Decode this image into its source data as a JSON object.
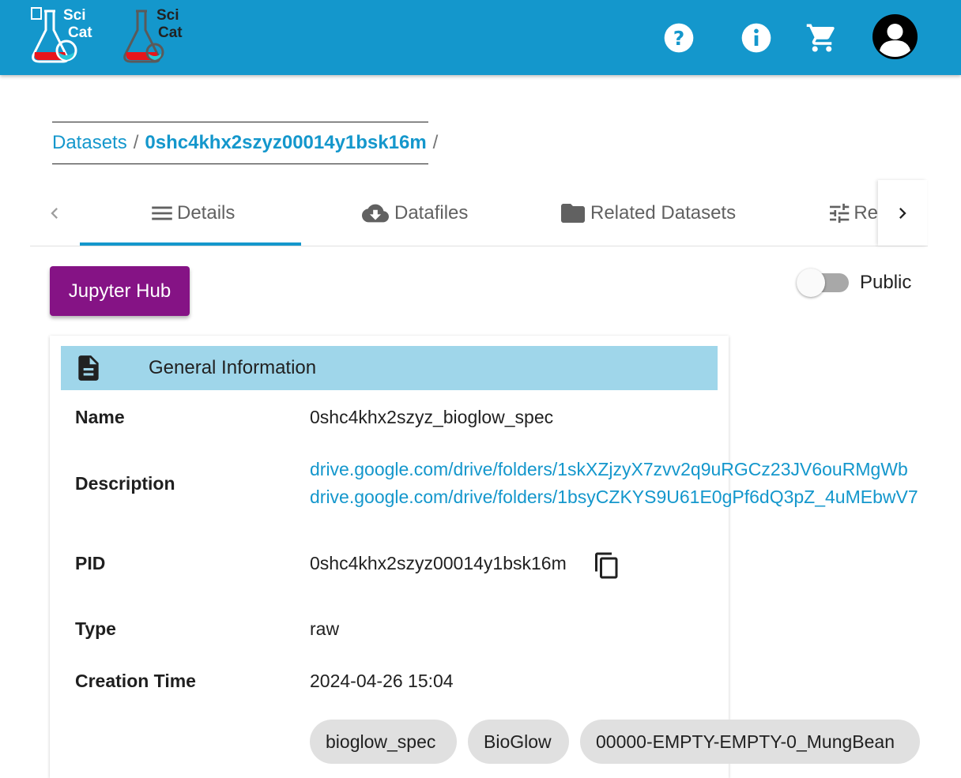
{
  "app": {
    "logo1_text_top": "Sci",
    "logo1_text_bottom": "Cat",
    "logo2_text_top": "Sci",
    "logo2_text_bottom": "Cat",
    "icons": [
      "help-icon",
      "info-icon",
      "cart-icon",
      "account-icon"
    ],
    "accent_color": "#1497cc"
  },
  "breadcrumb": {
    "root": "Datasets",
    "separator": "/",
    "current": "0shc4khx2szyz00014y1bsk16m"
  },
  "tabs": [
    {
      "label": "Details",
      "icon": "menu-lines-icon",
      "active": true
    },
    {
      "label": "Datafiles",
      "icon": "cloud-download-icon",
      "active": false
    },
    {
      "label": "Related Datasets",
      "icon": "folder-icon",
      "active": false
    },
    {
      "label": "Re",
      "icon": "tune-icon",
      "active": false
    }
  ],
  "actions": {
    "jupyter_label": "Jupyter Hub",
    "jupyter_color": "#851385",
    "public_label": "Public",
    "public_on": false
  },
  "general_info": {
    "title": "General Information",
    "name_label": "Name",
    "name_value": "0shc4khx2szyz_bioglow_spec",
    "description_label": "Description",
    "description_links": [
      "drive.google.com/drive/folders/1skXZjzyX7zvv2q9uRGCz23JV6ouRMgWb",
      "drive.google.com/drive/folders/1bsyCZKYS9U61E0gPf6dQ3pZ_4uMEbwV7"
    ],
    "pid_label": "PID",
    "pid_value": "0shc4khx2szyz00014y1bsk16m",
    "type_label": "Type",
    "type_value": "raw",
    "creation_label": "Creation Time",
    "creation_value": "2024-04-26 15:04",
    "keywords": [
      "bioglow_spec",
      "BioGlow",
      "00000-EMPTY-EMPTY-0_MungBean"
    ]
  }
}
